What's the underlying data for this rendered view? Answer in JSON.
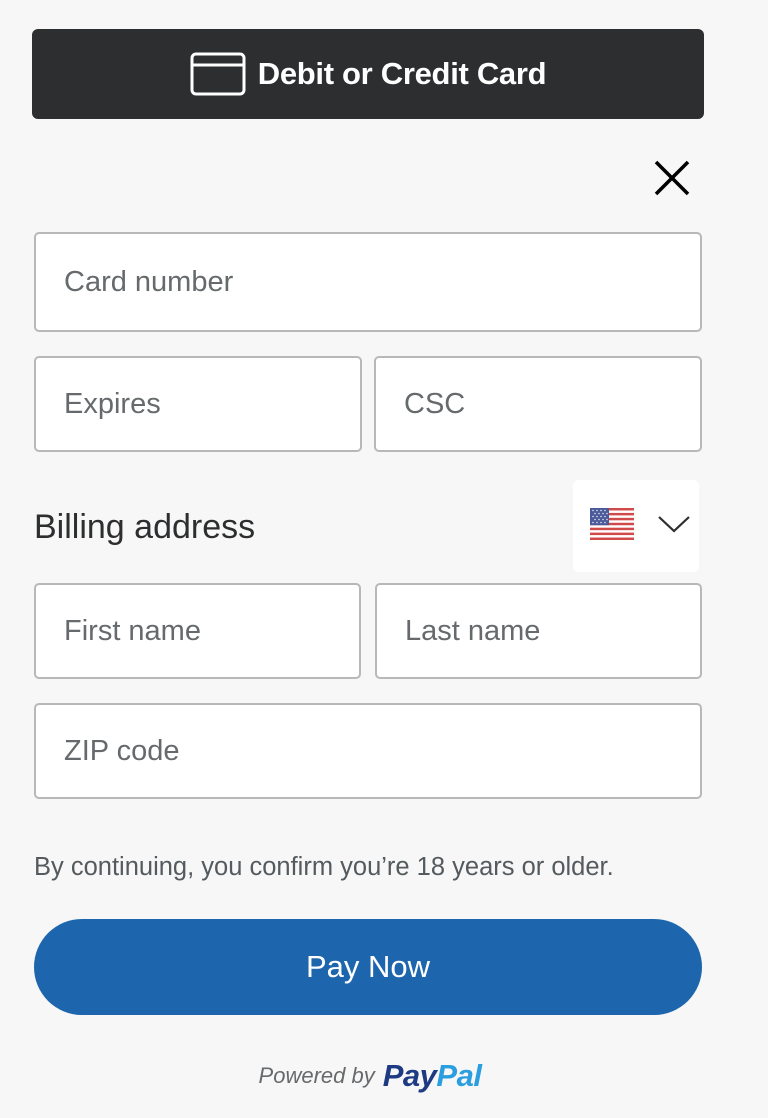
{
  "header": {
    "card_button_label": "Debit or Credit Card",
    "card_icon": "credit-card-icon"
  },
  "close_icon": "close-icon",
  "card": {
    "number_placeholder": "Card number",
    "expires_placeholder": "Expires",
    "csc_placeholder": "CSC"
  },
  "billing": {
    "title": "Billing address",
    "country_flag": "us-flag-icon",
    "first_name_placeholder": "First name",
    "last_name_placeholder": "Last name",
    "zip_placeholder": "ZIP code"
  },
  "disclaimer": "By continuing, you confirm you’re 18 years or older.",
  "pay_button_label": "Pay Now",
  "footer": {
    "powered_by": "Powered by",
    "brand_pay": "Pay",
    "brand_pal": "Pal"
  },
  "colors": {
    "header_button": "#2c2e2f",
    "pay_button": "#1d66ad",
    "paypal_dark": "#1d3a83",
    "paypal_light": "#2b9ee0"
  }
}
